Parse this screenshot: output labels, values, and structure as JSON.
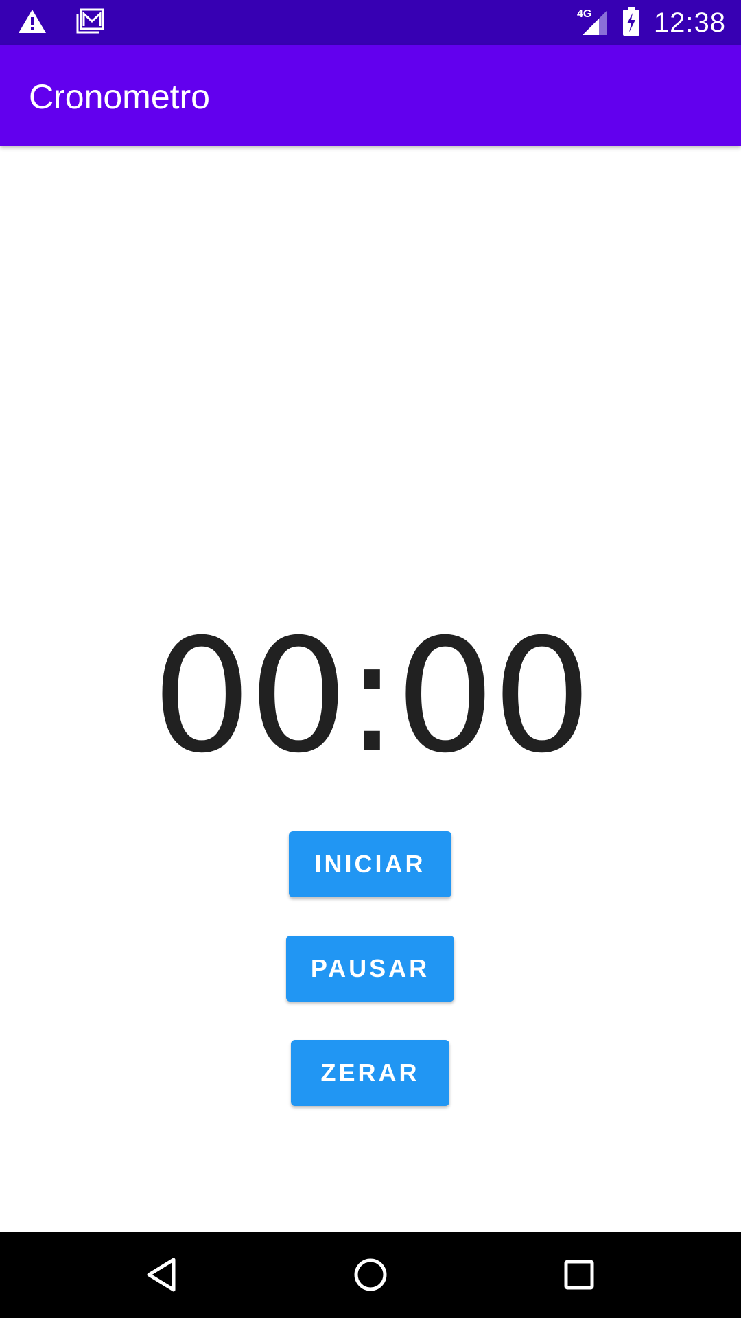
{
  "status_bar": {
    "time": "12:38",
    "network": "4G",
    "icons": [
      "warning-icon",
      "gallery-icon",
      "signal-icon",
      "battery-charging-icon"
    ]
  },
  "app_bar": {
    "title": "Cronometro"
  },
  "chronometer": {
    "display": "00:00"
  },
  "buttons": {
    "start": "INICIAR",
    "pause": "PAUSAR",
    "reset": "ZERAR"
  },
  "nav_bar": {
    "icons": [
      "back-icon",
      "home-icon",
      "recents-icon"
    ]
  },
  "colors": {
    "status_bar": "#3700b3",
    "app_bar": "#6200ee",
    "button": "#2196f3",
    "chrono_text": "#212121"
  }
}
